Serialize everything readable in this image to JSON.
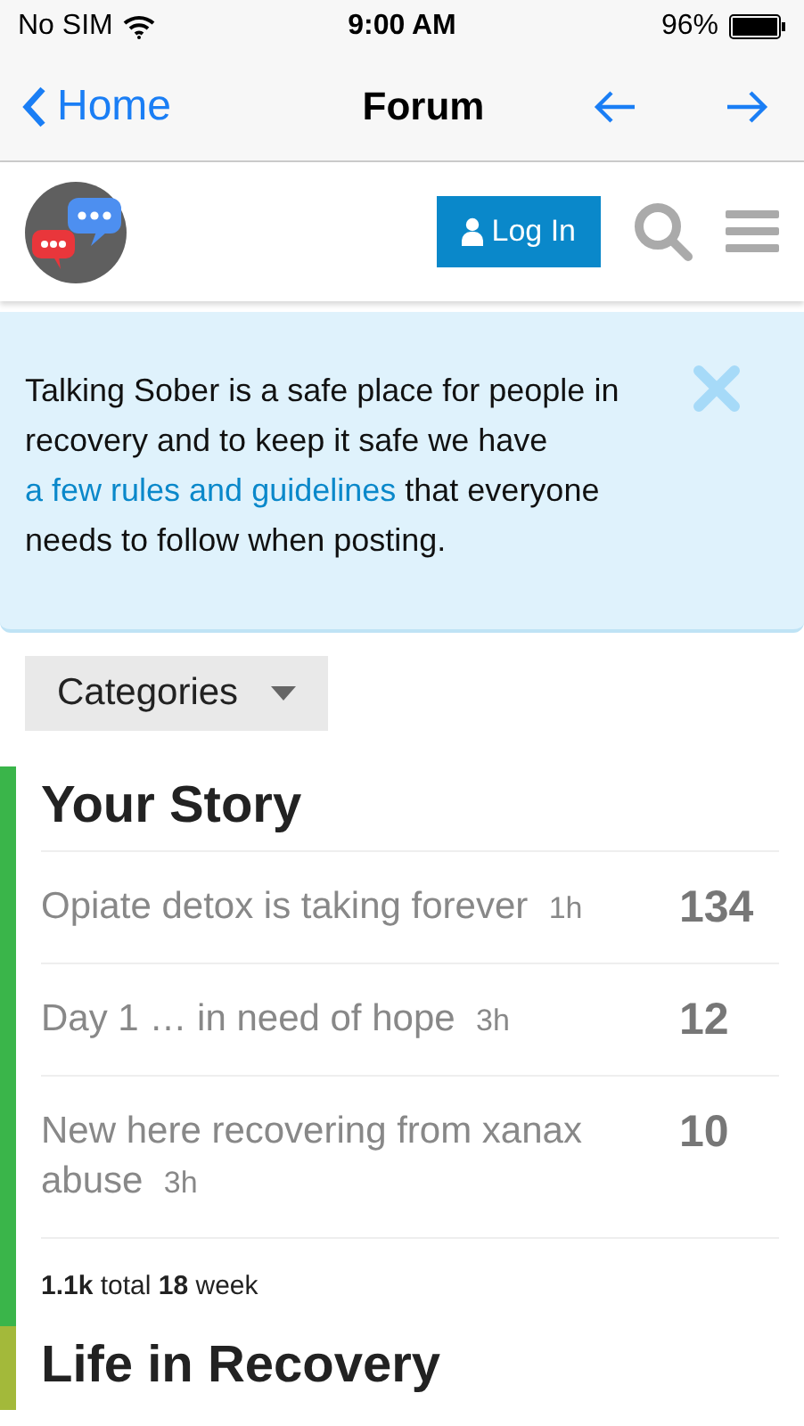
{
  "status_bar": {
    "carrier": "No SIM",
    "time": "9:00 AM",
    "battery": "96%"
  },
  "nav_bar": {
    "back": "Home",
    "title": "Forum"
  },
  "header": {
    "login": "Log In"
  },
  "notice": {
    "before": "Talking Sober is a safe place for people in recovery and to keep it safe we have ",
    "link": "a few rules and guidelines",
    "after": " that everyone needs to follow when posting."
  },
  "categories_button": "Categories",
  "categories": [
    {
      "name": "Your Story",
      "color": "#3ab54a",
      "topics": [
        {
          "title": "Opiate detox is taking forever",
          "age": "1h",
          "count": "134"
        },
        {
          "title": "Day 1 … in need of hope",
          "age": "3h",
          "count": "12"
        },
        {
          "title": "New here recovering from xanax abuse",
          "age": "3h",
          "count": "10"
        }
      ],
      "stats": "**1.1k** total  **18** week"
    },
    {
      "name": "Life in Recovery",
      "color": "#a3b93a"
    }
  ]
}
